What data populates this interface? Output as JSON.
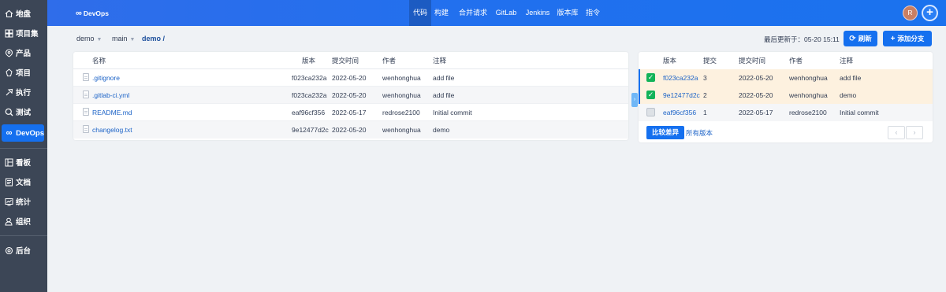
{
  "sidebar": {
    "items": [
      {
        "label": "地盘",
        "icon": "home-icon"
      },
      {
        "label": "项目集",
        "icon": "program-icon"
      },
      {
        "label": "产品",
        "icon": "product-icon"
      },
      {
        "label": "项目",
        "icon": "project-icon"
      },
      {
        "label": "执行",
        "icon": "execution-icon"
      },
      {
        "label": "测试",
        "icon": "test-icon"
      },
      {
        "label": "DevOps",
        "icon": "infinity-icon"
      },
      {
        "label": "看板",
        "icon": "kanban-icon"
      },
      {
        "label": "文档",
        "icon": "doc-icon"
      },
      {
        "label": "统计",
        "icon": "stats-icon"
      },
      {
        "label": "组织",
        "icon": "org-icon"
      },
      {
        "label": "后台",
        "icon": "settings-icon"
      }
    ]
  },
  "header": {
    "brand": "DevOps",
    "nav": [
      "代码",
      "构建",
      "合并请求",
      "GitLab",
      "Jenkins",
      "版本库",
      "指令"
    ],
    "avatar_initial": "R",
    "colors": {
      "primary": "#1570ef",
      "sidebar": "#3c4656"
    }
  },
  "toolbar": {
    "repo": "demo",
    "branch": "main",
    "path": "demo /",
    "updated": "最后更新于：05-20 15:11",
    "refresh": "刷新",
    "add_branch": "添加分支"
  },
  "files": {
    "headers": [
      "名称",
      "版本",
      "提交时间",
      "作者",
      "注释"
    ],
    "rows": [
      {
        "name": ".gitignore",
        "version": "f023ca232a",
        "date": "2022-05-20",
        "author": "wenhonghua",
        "comment": "add file"
      },
      {
        "name": ".gitlab-ci.yml",
        "version": "f023ca232a",
        "date": "2022-05-20",
        "author": "wenhonghua",
        "comment": "add file"
      },
      {
        "name": "README.md",
        "version": "eaf96cf356",
        "date": "2022-05-17",
        "author": "redrose2100",
        "comment": "Initial commit"
      },
      {
        "name": "changelog.txt",
        "version": "9e12477d2c",
        "date": "2022-05-20",
        "author": "wenhonghua",
        "comment": "demo"
      }
    ]
  },
  "history": {
    "headers": [
      "版本",
      "提交",
      "提交时间",
      "作者",
      "注释"
    ],
    "rows": [
      {
        "version": "f023ca232a",
        "seq": "3",
        "date": "2022-05-20",
        "author": "wenhonghua",
        "comment": "add file",
        "checked": true
      },
      {
        "version": "9e12477d2c",
        "seq": "2",
        "date": "2022-05-20",
        "author": "wenhonghua",
        "comment": "demo",
        "checked": true
      },
      {
        "version": "eaf96cf356",
        "seq": "1",
        "date": "2022-05-17",
        "author": "redrose2100",
        "comment": "Initial commit",
        "checked": false
      }
    ],
    "compare": "比较差异",
    "all_versions": "所有版本"
  }
}
